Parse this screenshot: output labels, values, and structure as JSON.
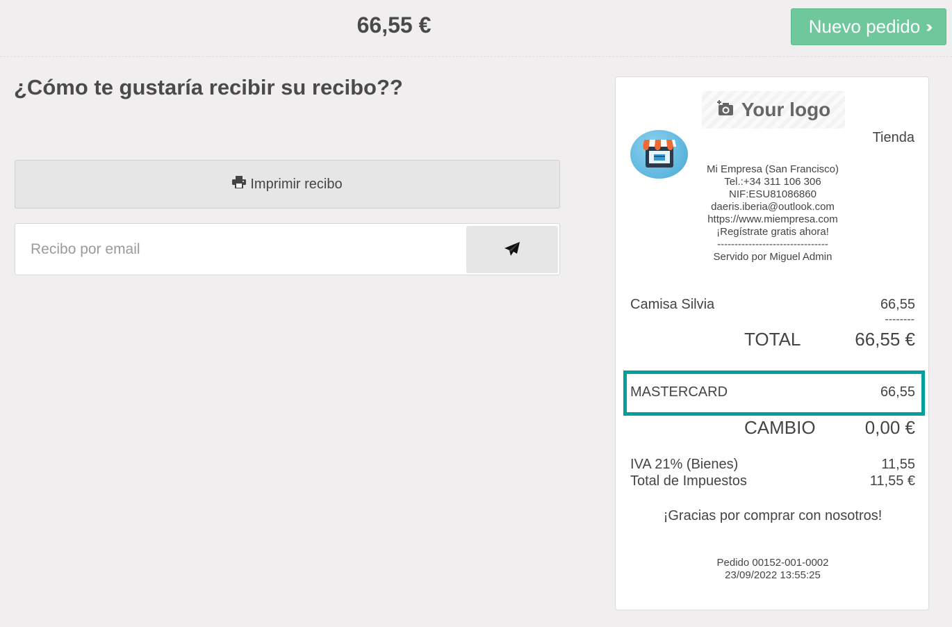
{
  "header": {
    "amount": "66,55 €",
    "new_order_label": "Nuevo pedido"
  },
  "colors": {
    "accent_green": "#6ec89b",
    "highlight_teal": "#00a09d",
    "background": "#f0eeee"
  },
  "receipt_options": {
    "question": "¿Cómo te gustaría recibir su recibo??",
    "print_label": "Imprimir recibo",
    "email_placeholder": "Recibo por email"
  },
  "receipt": {
    "logo_text": "Your logo",
    "shop_name": "Tienda",
    "company_lines": [
      "Mi Empresa (San Francisco)",
      "Tel.:+34 311 106 306",
      "NIF:ESU81086860",
      "daeris.iberia@outlook.com",
      "https://www.miempresa.com",
      "¡Regístrate gratis ahora!",
      "--------------------------------",
      "Servido por Miguel Admin"
    ],
    "line_item": {
      "name": "Camisa Silvia",
      "price": "66,55"
    },
    "separator": "--------",
    "total_label": "TOTAL",
    "total_value": "66,55 €",
    "payment": {
      "method": "MASTERCARD",
      "amount": "66,55"
    },
    "change_label": "CAMBIO",
    "change_value": "0,00 €",
    "tax_line": {
      "label": "IVA 21% (Bienes)",
      "value": "11,55"
    },
    "tax_total": {
      "label": "Total de Impuestos",
      "value": "11,55 €"
    },
    "thanks": "¡Gracias por comprar con nosotros!",
    "order_number": "Pedido 00152-001-0002",
    "order_datetime": "23/09/2022 13:55:25"
  }
}
